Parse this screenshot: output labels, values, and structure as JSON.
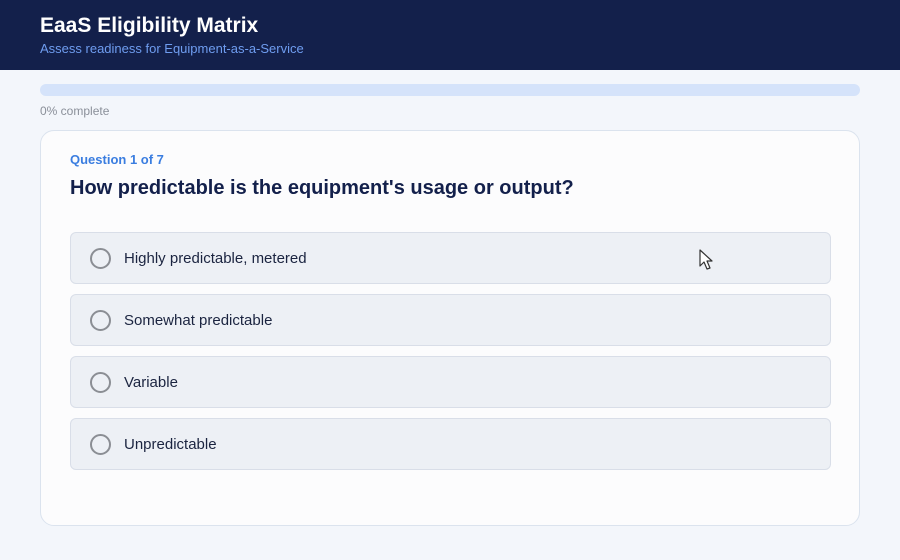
{
  "header": {
    "title": "EaaS Eligibility Matrix",
    "subtitle": "Assess readiness for Equipment-as-a-Service"
  },
  "progress": {
    "percent": 0,
    "label": "0% complete"
  },
  "question": {
    "counter": "Question 1 of 7",
    "text": "How predictable is the equipment's usage or output?",
    "options": [
      {
        "label": "Highly predictable, metered"
      },
      {
        "label": "Somewhat predictable"
      },
      {
        "label": "Variable"
      },
      {
        "label": "Unpredictable"
      }
    ]
  },
  "colors": {
    "header_bg": "#13204b",
    "accent": "#3a7de0",
    "progress_track": "#d5e3fa",
    "option_bg": "#edf0f5"
  },
  "icons": {
    "cursor": "mouse-pointer-icon",
    "radio": "radio-unchecked-icon"
  }
}
